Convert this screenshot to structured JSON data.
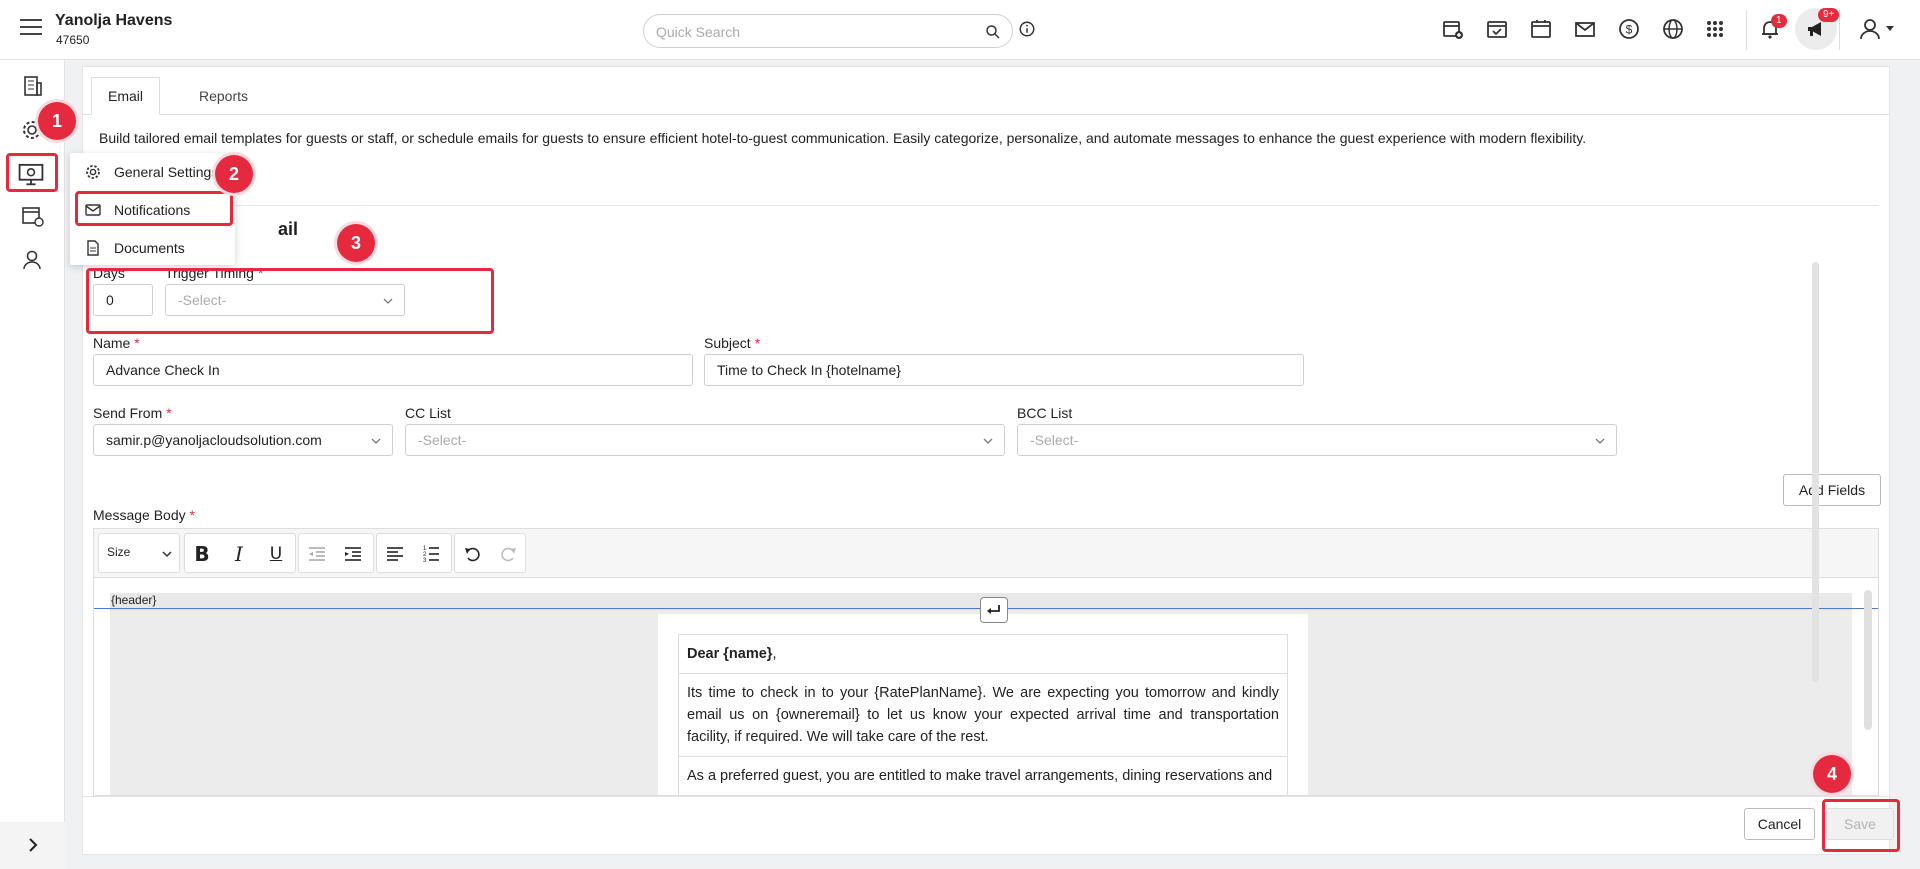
{
  "header": {
    "hotel_name": "Yanolja Havens",
    "hotel_id": "47650",
    "search_placeholder": "Quick Search",
    "notification_badge": "1",
    "announcement_badge": "9+"
  },
  "tabs": [
    {
      "label": "Email",
      "active": true
    },
    {
      "label": "Reports",
      "active": false
    }
  ],
  "description": "Build tailored email templates for guests or staff, or schedule emails for guests to ensure efficient hotel-to-guest communication. Easily categorize, personalize, and automate messages to enhance the guest experience with modern flexibility.",
  "section_title_partial": "ail",
  "submenu": {
    "items": [
      {
        "label": "General Settings",
        "icon": "gear-icon"
      },
      {
        "label": "Notifications",
        "icon": "mail-icon"
      },
      {
        "label": "Documents",
        "icon": "document-icon"
      }
    ]
  },
  "callouts": [
    "1",
    "2",
    "3",
    "4"
  ],
  "form": {
    "days_label": "Days",
    "days_value": "0",
    "trigger_label": "Trigger Timing",
    "trigger_placeholder": "-Select-",
    "required_mark": "*",
    "name_label": "Name",
    "name_value": "Advance Check In",
    "subject_label": "Subject",
    "subject_value": "Time to Check In {hotelname}",
    "send_from_label": "Send From",
    "send_from_value": "samir.p@yanoljacloudsolution.com",
    "cc_label": "CC List",
    "cc_placeholder": "-Select-",
    "bcc_label": "BCC List",
    "bcc_placeholder": "-Select-",
    "add_fields_label": "Add Fields",
    "message_body_label": "Message Body"
  },
  "editor": {
    "size_label": "Size",
    "header_token": "{header}",
    "greeting_bold": "Dear {name}",
    "greeting_suffix": ",",
    "paragraph1": "Its time to check in to your {RatePlanName}. We are expecting you tomorrow and kindly email us on {owneremail} to let us know your expected arrival time and transportation facility, if required. We will take care of the rest.",
    "paragraph2": "As a preferred guest, you are entitled to make travel arrangements, dining reservations and"
  },
  "footer": {
    "cancel_label": "Cancel",
    "save_label": "Save"
  },
  "colors": {
    "accent_red": "#e5293f",
    "link_blue": "#4a7bd0"
  }
}
